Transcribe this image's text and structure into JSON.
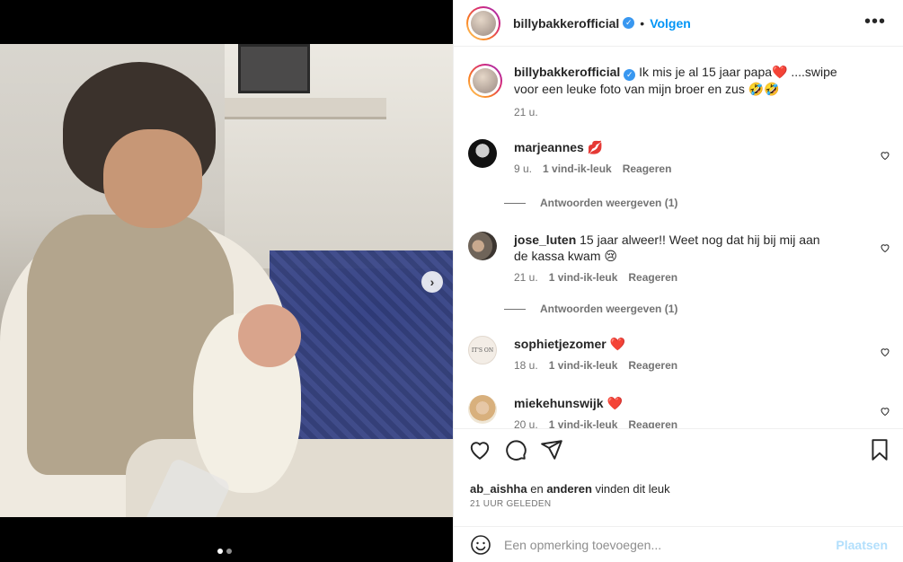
{
  "post": {
    "username": "billybakkerofficial",
    "follow_label": "Volgen",
    "more_label": "•••",
    "caption_text": "Ik mis je al 15 jaar papa❤️ ....swipe voor een leuke foto van mijn broer en zus 🤣🤣",
    "caption_time": "21 u."
  },
  "comments": [
    {
      "user": "marjeannes",
      "text": "💋",
      "time": "9 u.",
      "likes": "1 vind-ik-leuk",
      "reply": "Reageren",
      "replies": "Antwoorden weergeven (1)"
    },
    {
      "user": "jose_luten",
      "text": "15 jaar alweer!! Weet nog dat hij bij mij aan de kassa kwam 😢",
      "time": "21 u.",
      "likes": "1 vind-ik-leuk",
      "reply": "Reageren",
      "replies": "Antwoorden weergeven (1)"
    },
    {
      "user": "sophietjezomer",
      "text": "❤️",
      "time": "18 u.",
      "likes": "1 vind-ik-leuk",
      "reply": "Reageren",
      "avatar_text": "IT'S ON"
    },
    {
      "user": "miekehunswijk",
      "text": "❤️",
      "time": "20 u.",
      "likes": "1 vind-ik-leuk",
      "reply": "Reageren"
    }
  ],
  "likes": {
    "user": "ab_aishha",
    "connector": "en",
    "others": "anderen",
    "suffix": "vinden dit leuk"
  },
  "timestamp": "21 UUR GELEDEN",
  "add_comment": {
    "placeholder": "Een opmerking toevoegen...",
    "post_label": "Plaatsen"
  },
  "carousel": {
    "current": 1,
    "total": 2
  },
  "colors": {
    "accent": "#0095f6",
    "verified": "#3897f0",
    "post_disabled": "#b2dffc"
  }
}
